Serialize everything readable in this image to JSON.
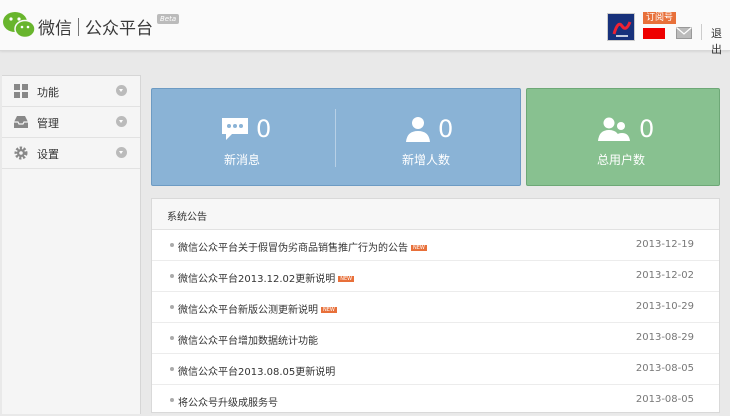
{
  "header": {
    "brand_name": "微信",
    "brand_product": "公众平台",
    "beta": "Beta",
    "account_type": "订阅号",
    "logout": "退出",
    "colors": {
      "accent": "#e8703a",
      "logo_green": "#68b52d"
    }
  },
  "sidebar": {
    "items": [
      {
        "label": "功能",
        "icon": "grid-icon"
      },
      {
        "label": "管理",
        "icon": "inbox-icon"
      },
      {
        "label": "设置",
        "icon": "gear-icon"
      }
    ]
  },
  "stats": [
    {
      "value": "0",
      "label": "新消息",
      "icon": "message-bubble-icon",
      "color": "#8ab3d6"
    },
    {
      "value": "0",
      "label": "新增人数",
      "icon": "user-icon",
      "color": "#8ab3d6"
    },
    {
      "value": "0",
      "label": "总用户数",
      "icon": "users-icon",
      "color": "#88c190"
    }
  ],
  "notices": {
    "title": "系统公告",
    "new_badge": "NEW",
    "rows": [
      {
        "text": "微信公众平台关于假冒伪劣商品销售推广行为的公告",
        "date": "2013-12-19",
        "is_new": true
      },
      {
        "text": "微信公众平台2013.12.02更新说明",
        "date": "2013-12-02",
        "is_new": true
      },
      {
        "text": "微信公众平台新版公测更新说明",
        "date": "2013-10-29",
        "is_new": true
      },
      {
        "text": "微信公众平台增加数据统计功能",
        "date": "2013-08-29",
        "is_new": false
      },
      {
        "text": "微信公众平台2013.08.05更新说明",
        "date": "2013-08-05",
        "is_new": false
      },
      {
        "text": "将公众号升级成服务号",
        "date": "2013-08-05",
        "is_new": false
      }
    ]
  }
}
